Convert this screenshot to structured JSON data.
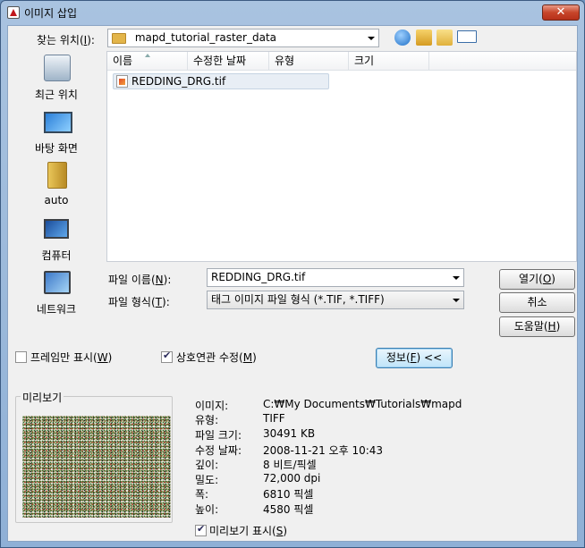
{
  "window": {
    "title": "이미지 삽입",
    "close_glyph": "✕"
  },
  "toolbar": {
    "look_in_label": "찾는 위치(",
    "look_in_hotkey": "I",
    "look_in_suffix": "):",
    "look_in_value": "mapd_tutorial_raster_data",
    "icons": [
      "back-icon",
      "up-folder-icon",
      "new-folder-icon",
      "view-menu-icon"
    ]
  },
  "places": [
    {
      "name": "place-recent",
      "label": "최근 위치",
      "icon": "recent-places-icon"
    },
    {
      "name": "place-desktop",
      "label": "바탕 화면",
      "icon": "desktop-icon"
    },
    {
      "name": "place-auto",
      "label": "auto",
      "icon": "user-folder-icon"
    },
    {
      "name": "place-computer",
      "label": "컴퓨터",
      "icon": "computer-icon"
    },
    {
      "name": "place-network",
      "label": "네트워크",
      "icon": "network-icon"
    }
  ],
  "filelist": {
    "columns": [
      "이름",
      "수정한 날짜",
      "유형",
      "크기"
    ],
    "items": [
      {
        "name": "REDDING_DRG.tif",
        "icon": "tif-file-icon"
      }
    ]
  },
  "filename": {
    "label": "파일 이름(",
    "hotkey": "N",
    "suffix": "):",
    "value": "REDDING_DRG.tif"
  },
  "filetype": {
    "label": "파일 형식(",
    "hotkey": "T",
    "suffix": "):",
    "value": "태그 이미지 파일 형식 (*.TIF, *.TIFF)"
  },
  "buttons": {
    "open": {
      "label": "열기(",
      "hotkey": "O",
      "suffix": ")"
    },
    "cancel": {
      "label": "취소"
    },
    "help": {
      "label": "도움말(",
      "hotkey": "H",
      "suffix": ")"
    },
    "info": {
      "label": "정보(",
      "hotkey": "F",
      "suffix": ") <<"
    }
  },
  "options": {
    "frame_only": {
      "label": "프레임만 표시(",
      "hotkey": "W",
      "suffix": ")",
      "checked": false
    },
    "interactive_edit": {
      "label": "상호연관 수정(",
      "hotkey": "M",
      "suffix": ")",
      "checked": true
    }
  },
  "preview": {
    "title": "미리보기",
    "show": {
      "label": "미리보기 표시(",
      "hotkey": "S",
      "suffix": ")",
      "checked": true
    }
  },
  "info": [
    {
      "key": "이미지:",
      "value": "C:₩My Documents₩Tutorials₩mapd"
    },
    {
      "key": "유형:",
      "value": "TIFF"
    },
    {
      "key": "파일 크기:",
      "value": "30491 KB"
    },
    {
      "key": "수정 날짜:",
      "value": "2008-11-21 오후 10:43"
    },
    {
      "key": "깊이:",
      "value": "8 비트/픽셀"
    },
    {
      "key": "밀도:",
      "value": "72,000 dpi"
    },
    {
      "key": "폭:",
      "value": "6810 픽셀"
    },
    {
      "key": "높이:",
      "value": "4580 픽셀"
    }
  ]
}
